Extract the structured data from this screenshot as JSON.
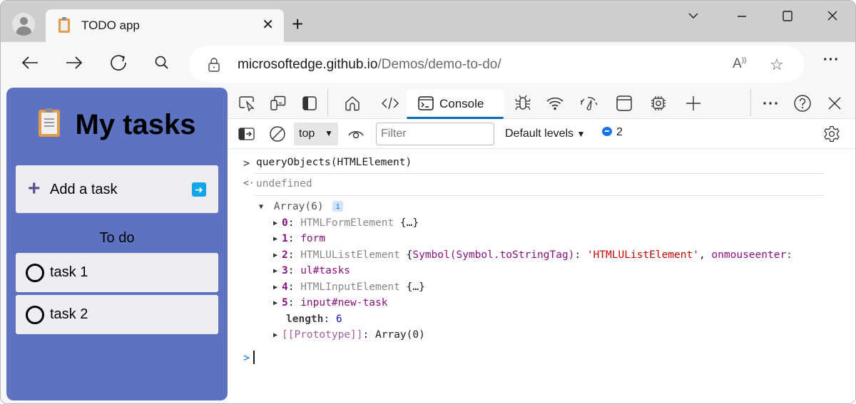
{
  "browser": {
    "tab": {
      "title": "TODO app",
      "icon": "clipboard-icon",
      "close_icon": "close-icon"
    },
    "new_tab_icon": "plus-icon",
    "window_controls": [
      "chevron-down-icon",
      "minimize-icon",
      "maximize-icon",
      "close-icon"
    ],
    "nav": [
      "back-arrow-icon",
      "forward-arrow-icon",
      "refresh-icon",
      "search-icon"
    ],
    "address": {
      "lock_icon": "lock-icon",
      "host": "microsoftedge.github.io",
      "path": "/Demos/demo-to-do/",
      "read_aloud_icon": "read-aloud-icon",
      "favorite_icon": "star-icon"
    },
    "menu_icon": "ellipsis-icon"
  },
  "todo_app": {
    "title": "My tasks",
    "add_task_label": "Add a task",
    "section_label": "To do",
    "tasks": [
      {
        "label": "task 1",
        "done": false
      },
      {
        "label": "task 2",
        "done": false
      }
    ],
    "colors": {
      "panel": "#5e72c2",
      "card": "#eeeef2",
      "submit": "#0ea5e9"
    }
  },
  "devtools": {
    "tabs": [
      {
        "name": "inspect",
        "icon": "inspect-icon"
      },
      {
        "name": "device-emulation",
        "icon": "device-icon"
      },
      {
        "name": "dock",
        "icon": "dock-panel-icon"
      },
      {
        "name": "welcome",
        "icon": "home-icon"
      },
      {
        "name": "elements",
        "icon": "code-icon"
      },
      {
        "name": "console",
        "icon": "console-icon",
        "label": "Console",
        "active": true
      },
      {
        "name": "sources",
        "icon": "bug-icon"
      },
      {
        "name": "network",
        "icon": "wifi-icon"
      },
      {
        "name": "performance",
        "icon": "gauge-icon"
      },
      {
        "name": "application",
        "icon": "window-icon"
      },
      {
        "name": "memory",
        "icon": "chip-icon"
      },
      {
        "name": "more-tools",
        "icon": "plus-icon"
      }
    ],
    "right_controls": [
      "ellipsis-icon",
      "help-icon",
      "close-icon"
    ],
    "console_toolbar": {
      "context": "top",
      "filter_placeholder": "Filter",
      "levels": "Default levels",
      "message_count": "2"
    },
    "console": {
      "input": "queryObjects(HTMLElement)",
      "return_value": "undefined",
      "array_label": "Array(6)",
      "info_badge": "i",
      "items": [
        {
          "index": "0",
          "sep": ": ",
          "value": "HTMLFormElement",
          "extra": " {…}",
          "style": "gray"
        },
        {
          "index": "1",
          "sep": ": ",
          "value": "form",
          "extra": "",
          "style": "prop"
        },
        {
          "index": "2",
          "sep": ": ",
          "value": "HTMLUListElement",
          "extra": "",
          "style": "gray"
        },
        {
          "index": "3",
          "sep": ": ",
          "value": "ul#tasks",
          "extra": "",
          "style": "prop"
        },
        {
          "index": "4",
          "sep": ": ",
          "value": "HTMLInputElement",
          "extra": " {…}",
          "style": "gray"
        },
        {
          "index": "5",
          "sep": ": ",
          "value": "input#new-task",
          "extra": "",
          "style": "prop"
        }
      ],
      "item2_preview": {
        "open": " {",
        "key": "Symbol(Symbol.toStringTag)",
        "colon": ": ",
        "value": "'HTMLUListElement'",
        "comma": ", ",
        "next_key": "onmouseenter:"
      },
      "length_key": "length",
      "length_value": "6",
      "prototype_key": "[[Prototype]]",
      "prototype_value": "Array(0)"
    }
  }
}
